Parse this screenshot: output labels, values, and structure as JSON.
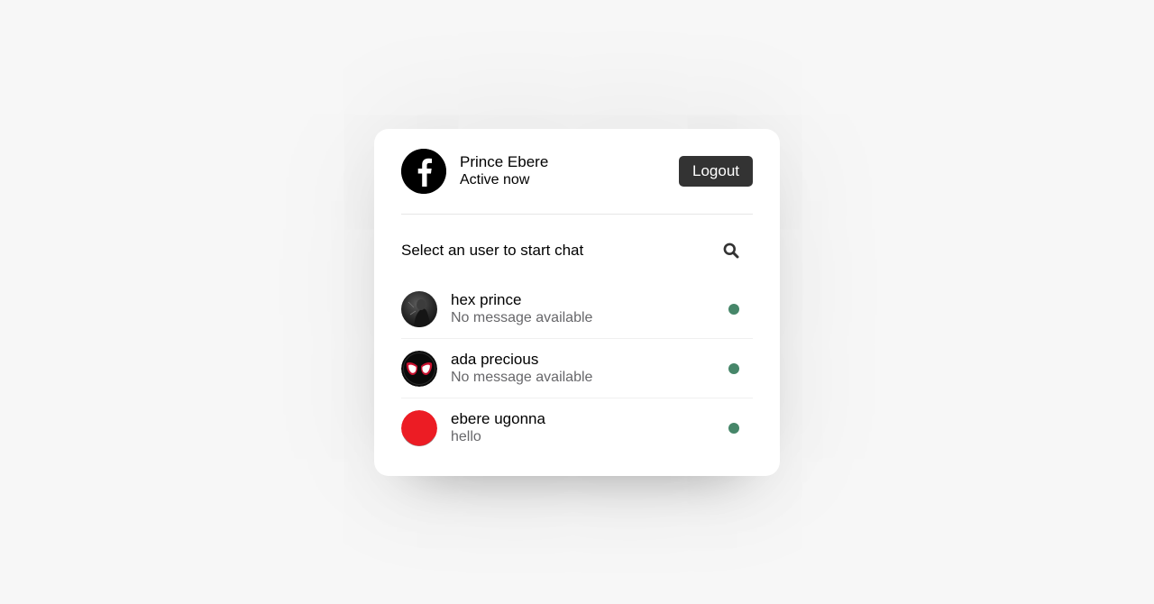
{
  "profile": {
    "name": "Prince Ebere",
    "status": "Active now",
    "avatar_icon": "facebook-logo-icon"
  },
  "header": {
    "logout_label": "Logout"
  },
  "search": {
    "prompt": "Select an user to start chat",
    "icon": "search-icon"
  },
  "users": [
    {
      "name": "hex prince",
      "message": "No message available",
      "avatar": "dark-photo-avatar",
      "online": true
    },
    {
      "name": "ada precious",
      "message": "No message available",
      "avatar": "spider-mask-avatar",
      "online": true
    },
    {
      "name": "ebere ugonna",
      "message": "hello",
      "avatar": "red-circle-avatar",
      "online": true
    }
  ],
  "colors": {
    "online_dot": "#468669",
    "logout_bg": "#333333",
    "avatar_red": "#ec1c24"
  }
}
